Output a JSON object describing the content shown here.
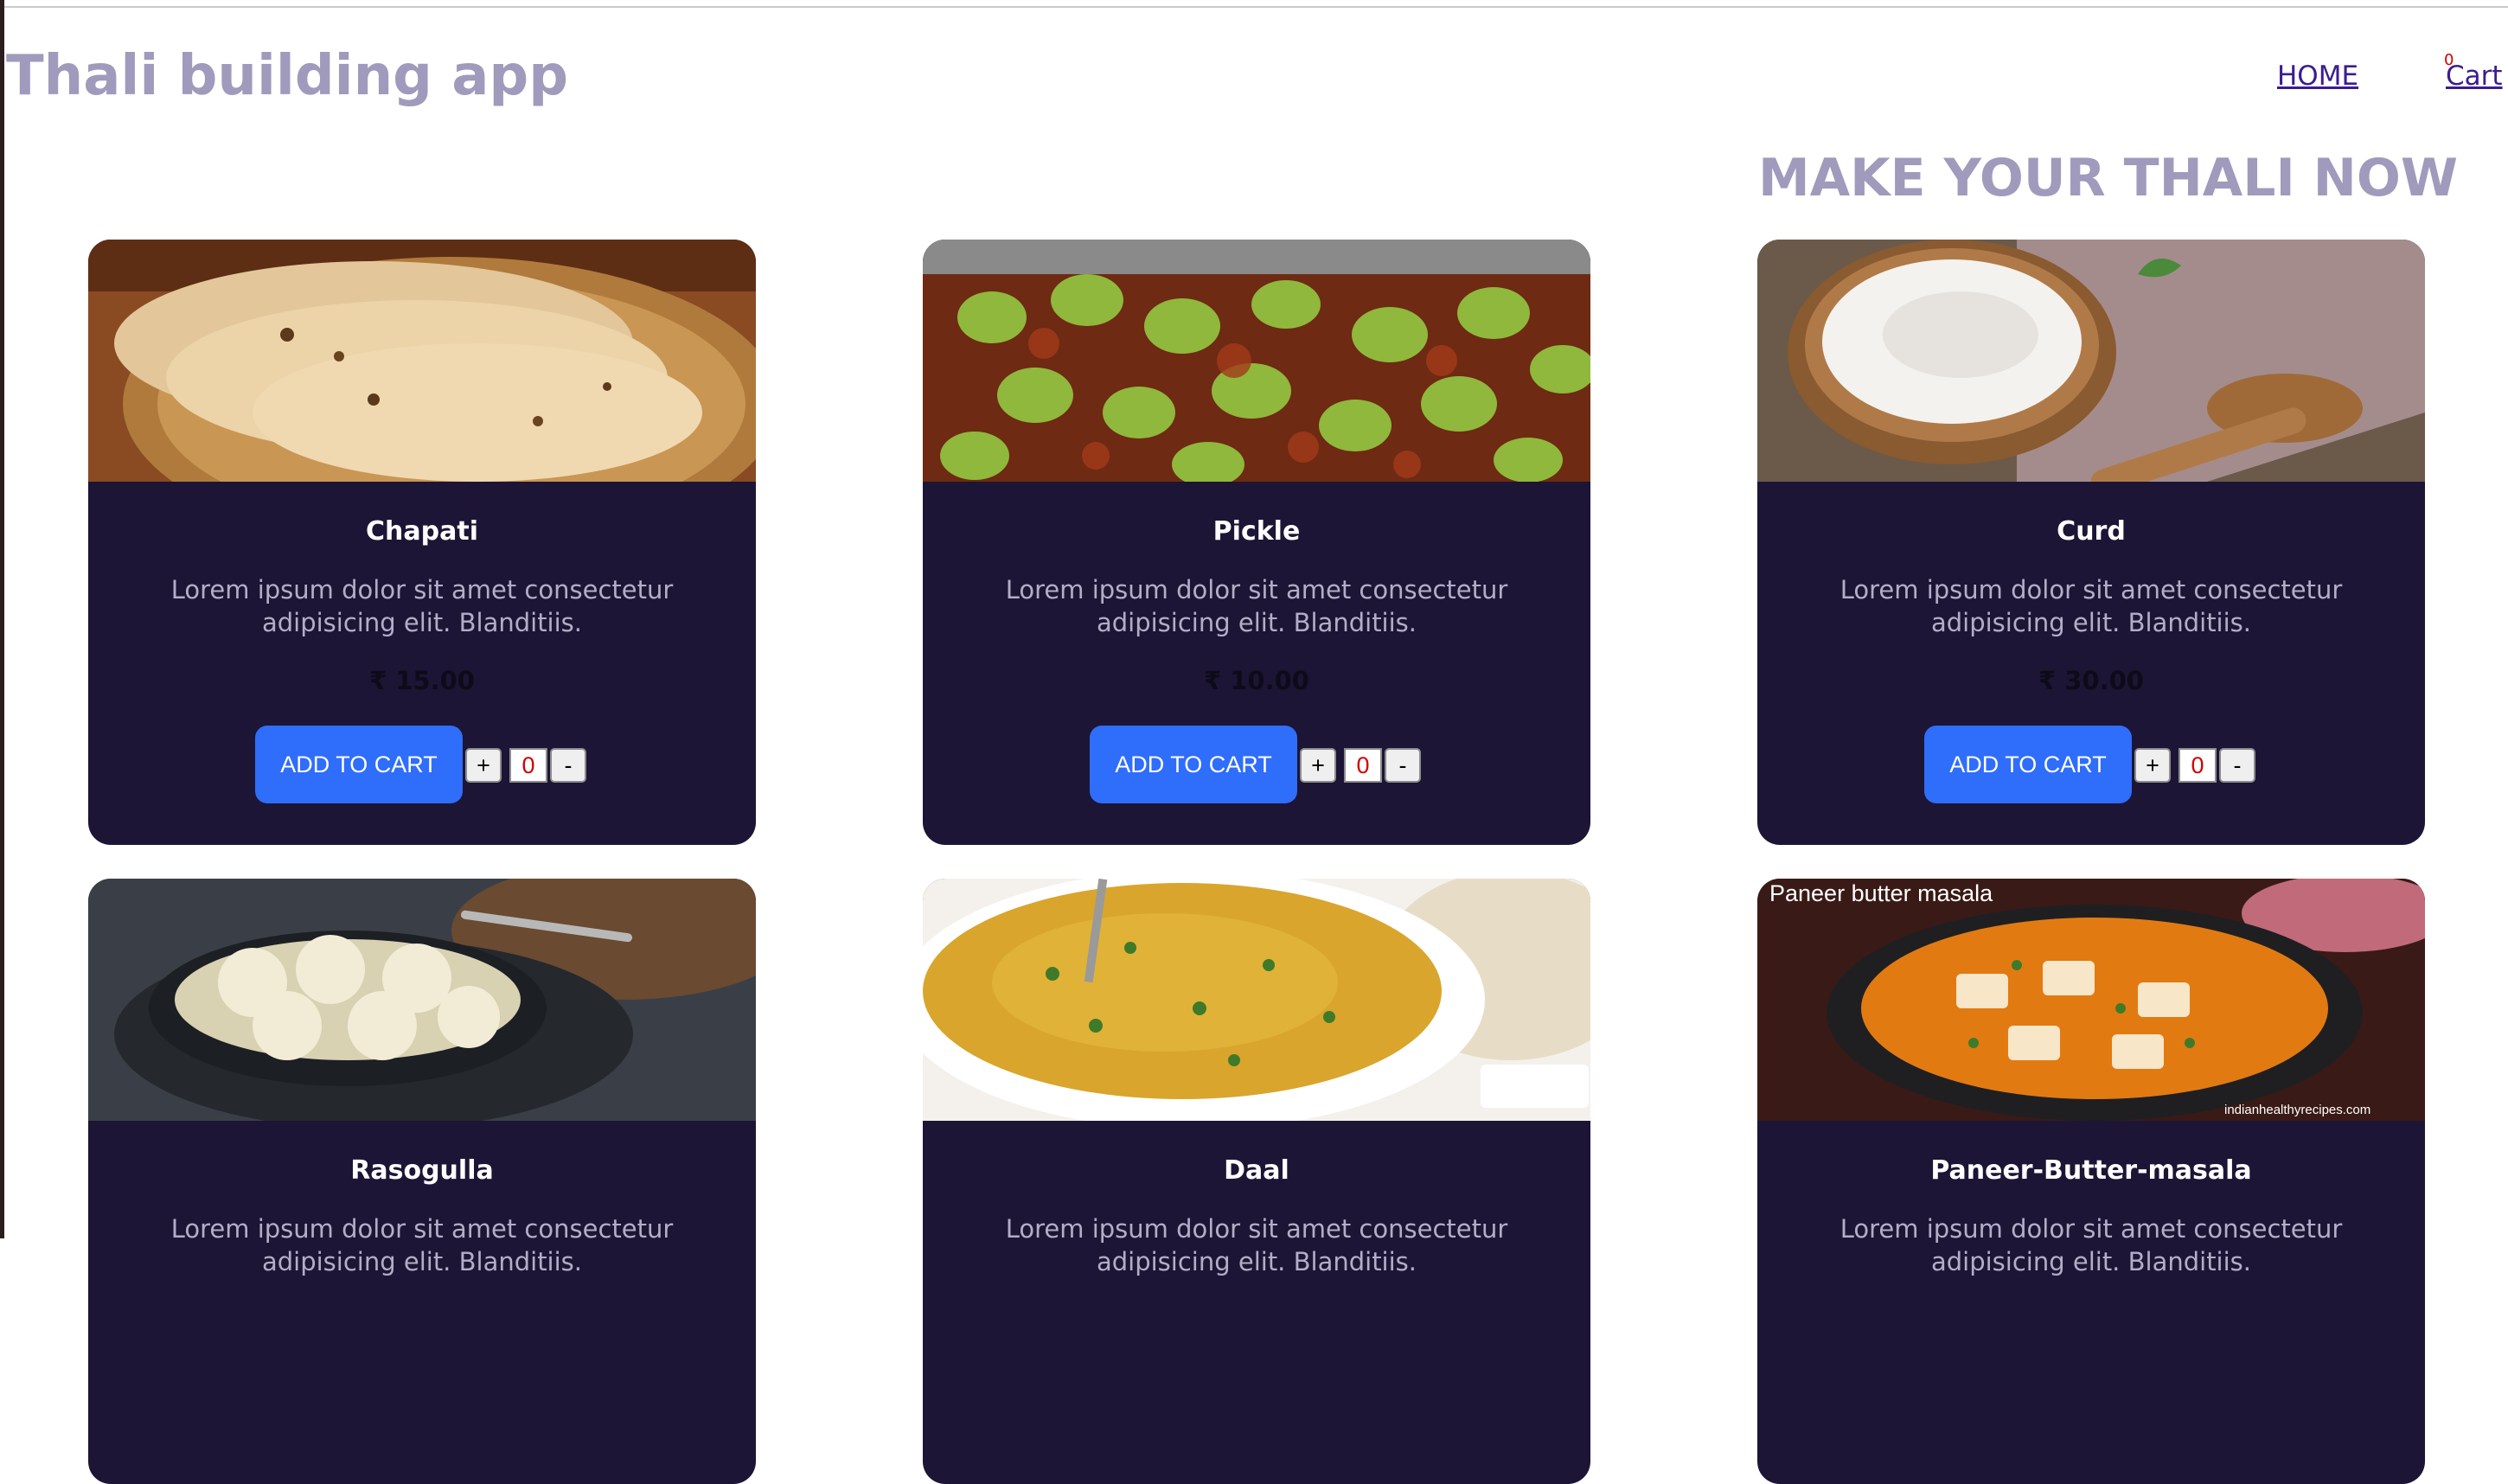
{
  "header": {
    "brand": "Thali building app",
    "nav_home": "HOME",
    "cart_label": "Cart",
    "cart_count": "0"
  },
  "headline": "MAKE YOUR THALI NOW",
  "items": [
    {
      "name": "Chapati",
      "description": "Lorem ipsum dolor sit amet consectetur adipisicing elit. Blanditiis.",
      "price": "₹ 15.00",
      "button": "ADD TO CART",
      "plus": "+",
      "qty": "0",
      "minus": "-"
    },
    {
      "name": "Pickle",
      "description": "Lorem ipsum dolor sit amet consectetur adipisicing elit. Blanditiis.",
      "price": "₹ 10.00",
      "button": "ADD TO CART",
      "plus": "+",
      "qty": "0",
      "minus": "-"
    },
    {
      "name": "Curd",
      "description": "Lorem ipsum dolor sit amet consectetur adipisicing elit. Blanditiis.",
      "price": "₹ 30.00",
      "button": "ADD TO CART",
      "plus": "+",
      "qty": "0",
      "minus": "-"
    },
    {
      "name": "Rasogulla",
      "description": "Lorem ipsum dolor sit amet consectetur adipisicing elit. Blanditiis."
    },
    {
      "name": "Daal",
      "description": "Lorem ipsum dolor sit amet consectetur adipisicing elit. Blanditiis."
    },
    {
      "name": "Paneer-Butter-masala",
      "description": "Lorem ipsum dolor sit amet consectetur adipisicing elit. Blanditiis.",
      "photo_caption": "Paneer butter masala",
      "photo_credit": "indianhealthyrecipes.com"
    }
  ],
  "colors": {
    "brand": "#a09abc",
    "card_bg": "#1c1535",
    "button": "#2f6dfb",
    "link": "#3b1d8f",
    "qty_text": "#d40000"
  }
}
